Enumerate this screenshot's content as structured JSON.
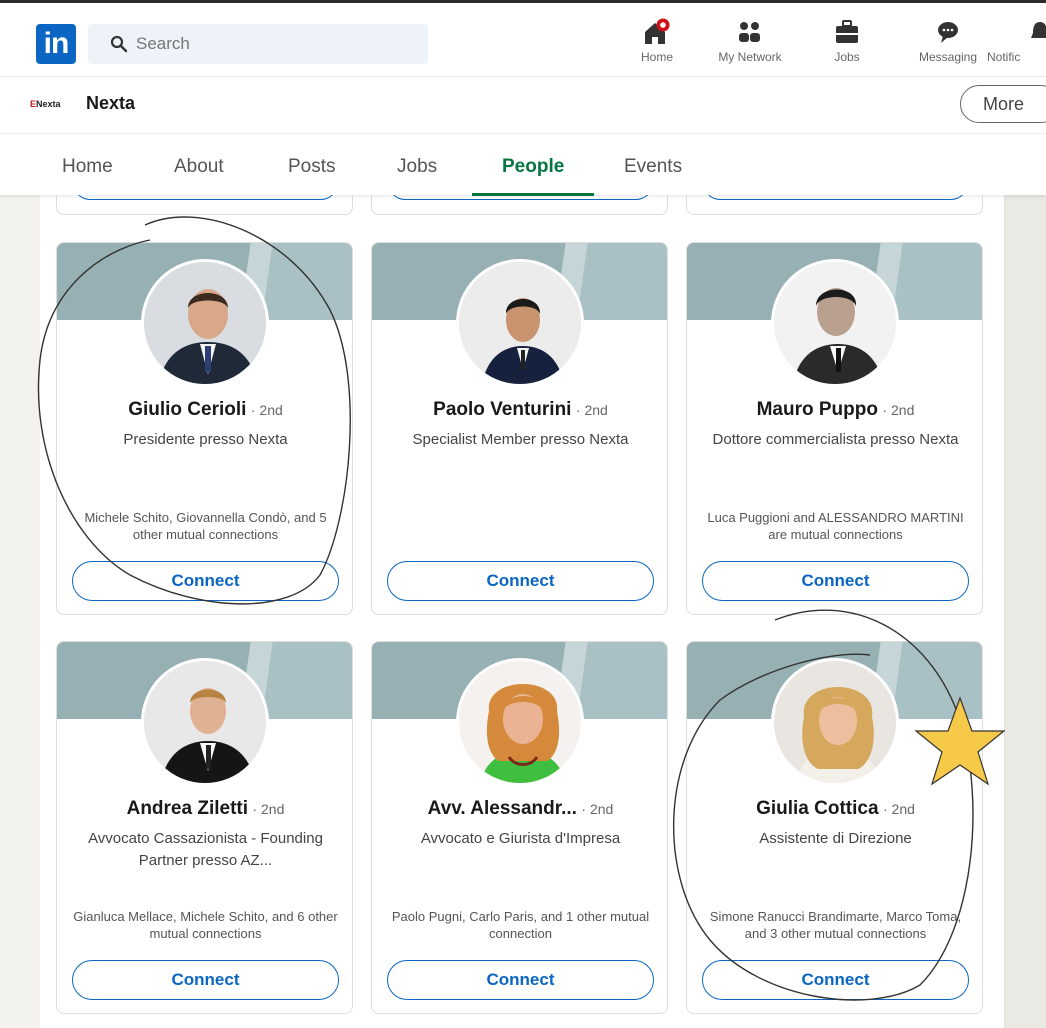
{
  "topnav": {
    "logo_text": "in",
    "search_placeholder": "Search",
    "items": [
      {
        "label": "Home",
        "icon": "home-icon"
      },
      {
        "label": "My Network",
        "icon": "network-icon"
      },
      {
        "label": "Jobs",
        "icon": "briefcase-icon"
      },
      {
        "label": "Messaging",
        "icon": "messaging-icon"
      },
      {
        "label": "Notific",
        "icon": "bell-icon"
      }
    ]
  },
  "company": {
    "logo_text": "Nexta",
    "name": "Nexta",
    "more_label": "More",
    "brand_color": "#c0232c"
  },
  "tabs": [
    {
      "label": "Home"
    },
    {
      "label": "About"
    },
    {
      "label": "Posts"
    },
    {
      "label": "Jobs"
    },
    {
      "label": "People",
      "active": true
    },
    {
      "label": "Events"
    }
  ],
  "people": [
    {
      "name": "Giulio Cerioli",
      "degree": "· 2nd",
      "headline": "Presidente presso Nexta",
      "mutual": "Michele Schito, Giovannella Condò, and 5 other mutual connections",
      "connect_label": "Connect"
    },
    {
      "name": "Paolo Venturini",
      "degree": "· 2nd",
      "headline": "Specialist Member presso Nexta",
      "mutual": "",
      "connect_label": "Connect"
    },
    {
      "name": "Mauro Puppo",
      "degree": "· 2nd",
      "headline": "Dottore commercialista presso Nexta",
      "mutual": "Luca Puggioni and ALESSANDRO MARTINI are mutual connections",
      "connect_label": "Connect"
    },
    {
      "name": "Andrea Ziletti",
      "degree": "· 2nd",
      "headline": "Avvocato Cassazionista - Founding Partner presso AZ...",
      "mutual": "Gianluca Mellace, Michele Schito, and 6 other mutual connections",
      "connect_label": "Connect"
    },
    {
      "name": "Avv. Alessandr...",
      "degree": "· 2nd",
      "headline": "Avvocato e Giurista d'Impresa",
      "mutual": "Paolo Pugni, Carlo Paris, and 1 other mutual connection",
      "connect_label": "Connect"
    },
    {
      "name": "Giulia Cottica",
      "degree": "· 2nd",
      "headline": "Assistente di Direzione",
      "mutual": "Simone Ranucci Brandimarte, Marco Toma, and 3 other mutual connections",
      "connect_label": "Connect"
    }
  ],
  "colors": {
    "accent": "#0a66c2",
    "active_tab": "#057642",
    "annotation_star": "#f7c948"
  }
}
